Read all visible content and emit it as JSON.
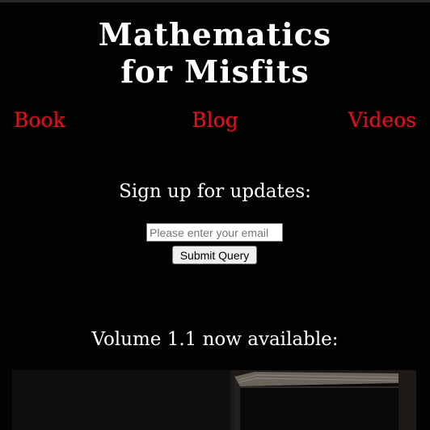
{
  "site": {
    "title_line1": "Mathematics",
    "title_line2": "for Misfits"
  },
  "nav": {
    "book": "Book",
    "blog": "Blog",
    "videos": "Videos",
    "link_color": "#e3111b"
  },
  "signup": {
    "heading": "Sign up for updates:",
    "email_placeholder": "Please enter your email",
    "email_value": "",
    "submit_label": "Submit Query"
  },
  "promo": {
    "heading": "Volume 1.1 now available:",
    "image_subject": "book-cover-photo"
  },
  "colors": {
    "background": "#030303",
    "text": "#ffffff",
    "accent": "#e3111b"
  }
}
